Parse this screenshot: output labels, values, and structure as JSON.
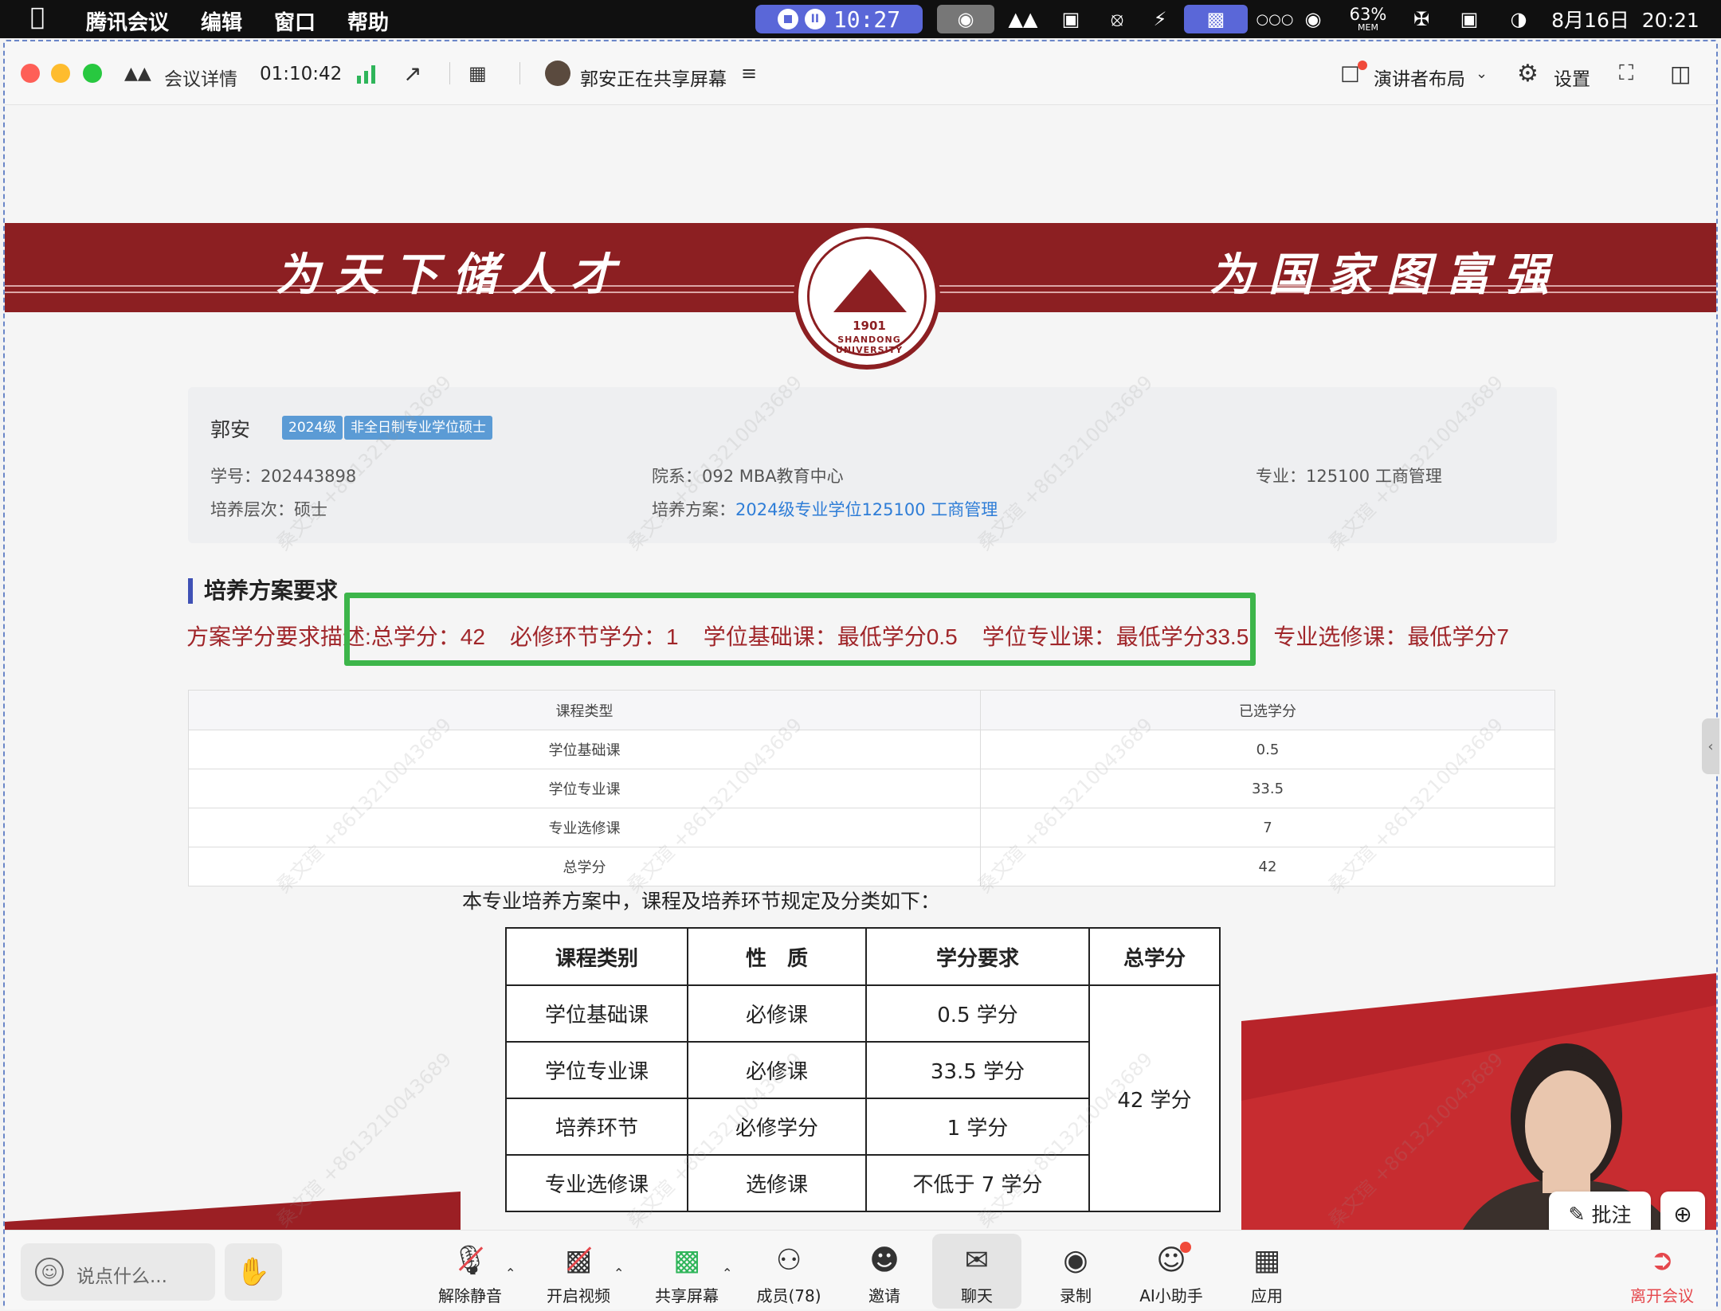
{
  "menubar": {
    "app_name": "腾讯会议",
    "menus": [
      "编辑",
      "窗口",
      "帮助"
    ],
    "timer": "10:27",
    "mem_percent": "63%",
    "mem_label": "MEM",
    "datetime": "8月16日  20:21"
  },
  "toolbar": {
    "meeting_details": "会议详情",
    "duration": "01:10:42",
    "sharing_status": "郭安正在共享屏幕",
    "layout": "演讲者布局",
    "settings": "设置"
  },
  "banner": {
    "left_slogan": "为天下储人才",
    "right_slogan": "为国家图富强",
    "seal_year": "1901",
    "seal_name": "SHANDONG UNIVERSITY"
  },
  "student": {
    "name": "郭安",
    "tags": [
      "2024级",
      "非全日制专业学位硕士"
    ],
    "student_id": "学号：202443898",
    "department": "院系：092 MBA教育中心",
    "major": "专业：125100 工商管理",
    "level": "培养层次：硕士",
    "plan_label": "培养方案：",
    "plan_link": "2024级专业学位125100 工商管理"
  },
  "requirements": {
    "title": "培养方案要求",
    "description": "方案学分要求描述:总学分：42    必修环节学分：1    学位基础课：最低学分0.5    学位专业课：最低学分33.5    专业选修课：最低学分7"
  },
  "credit_table": {
    "headers": [
      "课程类型",
      "已选学分"
    ],
    "rows": [
      [
        "学位基础课",
        "0.5"
      ],
      [
        "学位专业课",
        "33.5"
      ],
      [
        "专业选修课",
        "7"
      ],
      [
        "总学分",
        "42"
      ]
    ]
  },
  "ppt": {
    "caption": "本专业培养方案中，课程及培养环节规定及分类如下：",
    "headers": [
      "课程类别",
      "性　质",
      "学分要求",
      "总学分"
    ],
    "rows": [
      [
        "学位基础课",
        "必修课",
        "0.5 学分"
      ],
      [
        "学位专业课",
        "必修课",
        "33.5 学分"
      ],
      [
        "培养环节",
        "必修学分",
        "1 学分"
      ],
      [
        "专业选修课",
        "选修课",
        "不低于 7 学分"
      ]
    ],
    "total": "42 学分"
  },
  "overlay": {
    "annotate": "批注"
  },
  "bottom": {
    "chat_placeholder": "说点什么...",
    "buttons": [
      {
        "label": "解除静音"
      },
      {
        "label": "开启视频"
      },
      {
        "label": "共享屏幕"
      },
      {
        "label": "成员(78)"
      },
      {
        "label": "邀请"
      },
      {
        "label": "聊天"
      },
      {
        "label": "录制"
      },
      {
        "label": "AI小助手"
      },
      {
        "label": "应用"
      }
    ],
    "leave": "离开会议"
  },
  "colors": {
    "banner_red": "#8c1f22",
    "highlight_green": "#3db54a",
    "link_blue": "#2e7dd7",
    "leave_red": "#e5484d"
  }
}
